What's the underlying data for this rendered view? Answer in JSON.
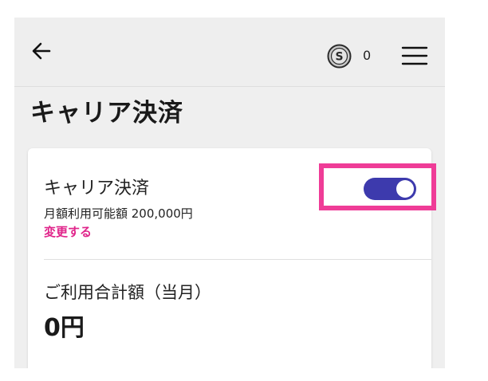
{
  "header": {
    "back_icon": "arrow-left-icon",
    "coin_icon": "coin-s-icon",
    "coin_letter": "S",
    "points": "0",
    "menu_icon": "hamburger-menu-icon"
  },
  "page": {
    "title": "キャリア決済"
  },
  "card": {
    "title": "キャリア決済",
    "monthly_limit": "月額利用可能額 200,000円",
    "change_link": "変更する",
    "toggle_state": "on",
    "usage_label": "ご利用合計額（当月）",
    "usage_amount": "0円"
  },
  "colors": {
    "toggle_on": "#3d3aad",
    "link_pink": "#e0248a",
    "highlight": "#ef3c97",
    "screen_bg": "#efefef"
  }
}
